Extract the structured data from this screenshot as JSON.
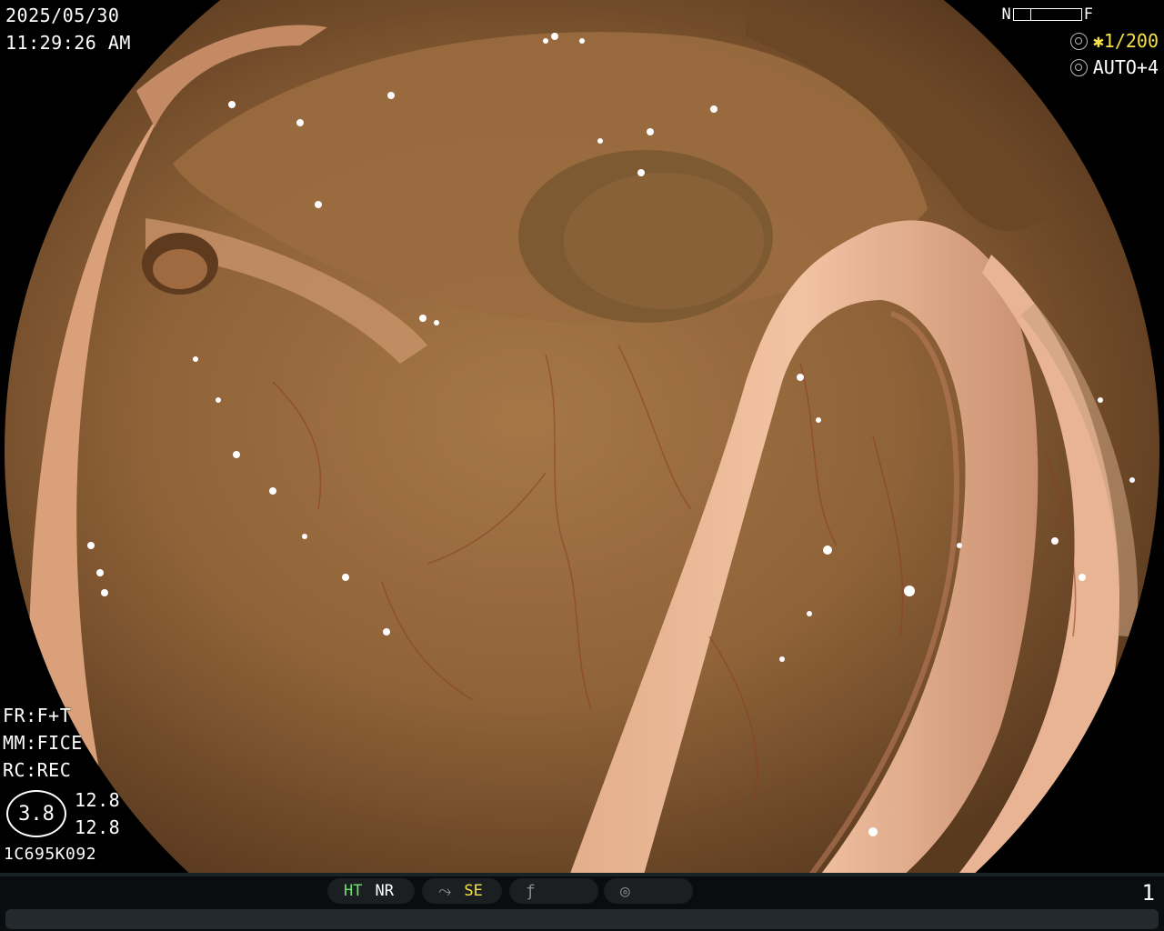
{
  "osd": {
    "date": "2025/05/30",
    "time": "11:29:26  AM",
    "nf_left": "N",
    "nf_right": "F",
    "shutter_value": "✱1/200",
    "iris_value": "AUTO+4",
    "fr": "FR:F+T",
    "mm": "MM:FICE",
    "rc": "RC:REC",
    "ring_value": "3.8",
    "ring_val_1": "12.8",
    "ring_val_2": "12.8",
    "code": "1C695K092"
  },
  "bottombar": {
    "ht": "HT",
    "nr": "NR",
    "se": "SE",
    "page": "1"
  },
  "colors": {
    "ht": "#6fe16f",
    "se": "#f6e04a",
    "shutter": "#f6e04a"
  },
  "icons": [
    "shutter-icon",
    "iris-icon",
    "enhance-icon",
    "color-icon",
    "scope-icon"
  ]
}
